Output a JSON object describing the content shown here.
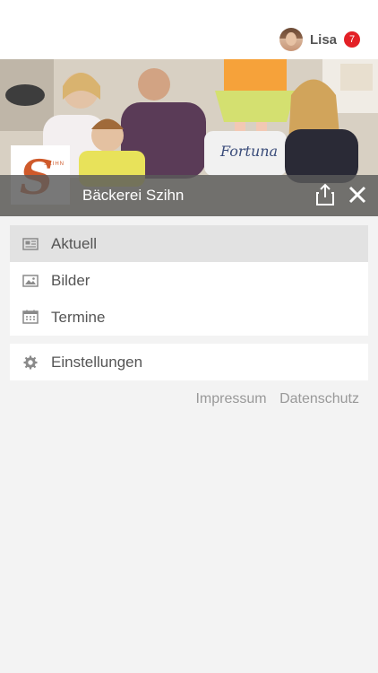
{
  "user": {
    "name": "Lisa",
    "notifications": "7"
  },
  "header": {
    "bakery_name": "Bäckerei Szihn",
    "logo_letter": "S",
    "logo_small": "SZIHN"
  },
  "menu": [
    {
      "label": "Aktuell",
      "icon": "newspaper-icon"
    },
    {
      "label": "Bilder",
      "icon": "image-icon"
    },
    {
      "label": "Termine",
      "icon": "calendar-icon"
    }
  ],
  "settings": {
    "label": "Einstellungen",
    "icon": "gear-icon"
  },
  "footer": {
    "impressum": "Impressum",
    "datenschutz": "Datenschutz"
  },
  "colors": {
    "accent": "#cf5a2b",
    "badge": "#e32026",
    "bar": "#5a5a5a",
    "active": "#e2e2e2"
  }
}
